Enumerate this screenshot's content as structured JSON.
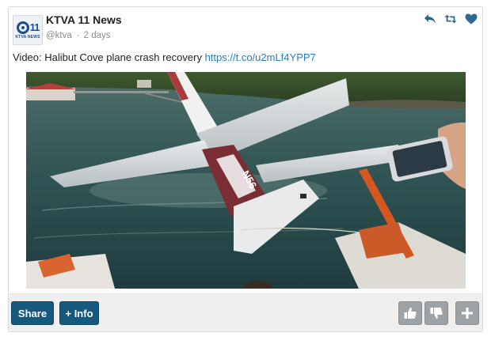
{
  "tweet": {
    "account_name": "KTVA 11 News",
    "handle": "@ktva",
    "separator": "·",
    "time": "2 days",
    "text_prefix": "Video: Halibut Cove plane crash recovery",
    "link": "https://t.co/u2mLf4YPP7",
    "avatar": {
      "number": "11",
      "caption": "KTVA NEWS"
    },
    "actions": [
      "reply-icon",
      "retweet-icon",
      "heart-icon"
    ]
  },
  "media": {
    "description_icon": "plane-crash-photo",
    "fuselage_text": "N56"
  },
  "footer": {
    "share_label": "Share",
    "info_label": "+ Info",
    "icons": [
      "thumbs-up-icon",
      "thumbs-down-icon",
      "plus-icon"
    ]
  },
  "colors": {
    "link": "#2b7bb9",
    "button_blue": "#17597c",
    "button_gray": "#9da2a7",
    "avatar_blue": "#1d4f8a"
  }
}
